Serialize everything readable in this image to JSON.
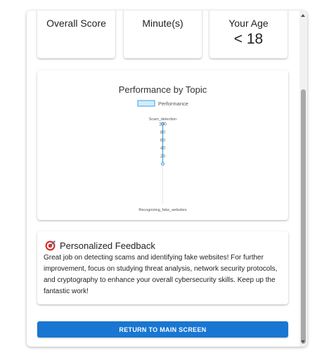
{
  "stats": {
    "overall_score_label": "Overall Score",
    "minutes_label": "Minute(s)",
    "age_label": "Your Age",
    "age_value": "< 18"
  },
  "chart_data": {
    "type": "radar",
    "title": "Performance by Topic",
    "categories": [
      "Scam_detection",
      "Recognizing_fake_websites"
    ],
    "series": [
      {
        "name": "Performance",
        "values": [
          100,
          0
        ]
      }
    ],
    "ticks": [
      20,
      40,
      60,
      80,
      100
    ],
    "rlim": [
      0,
      100
    ],
    "legend_position": "top",
    "colors": {
      "line": "#36a2eb",
      "fill": "#d6ebf9"
    }
  },
  "feedback": {
    "icon": "target-icon",
    "title": "Personalized Feedback",
    "text": "Great job on detecting scams and identifying fake websites! For further improvement, focus on studying threat analysis, network security protocols, and cryptography to enhance your overall cybersecurity skills. Keep up the fantastic work!"
  },
  "return_button_label": "RETURN TO MAIN SCREEN",
  "colors": {
    "accent": "#1976d2"
  }
}
